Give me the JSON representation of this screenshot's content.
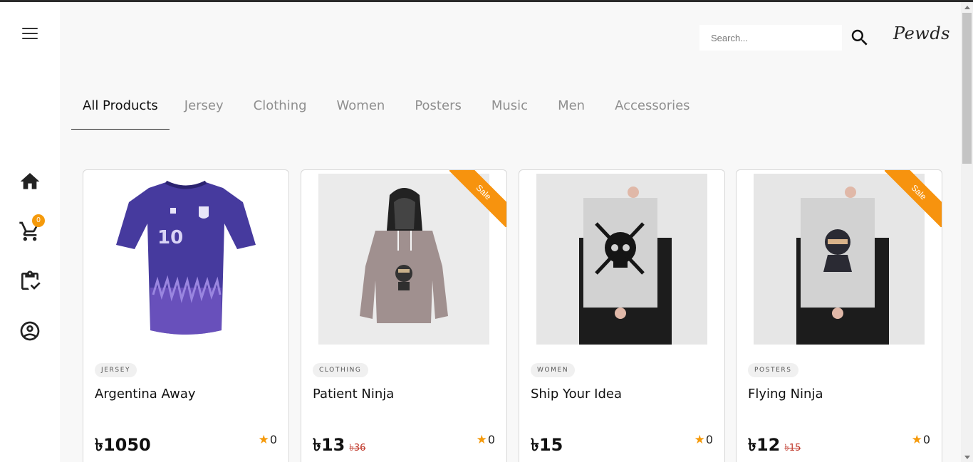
{
  "header": {
    "search_placeholder": "Search...",
    "logo": "Pewds"
  },
  "sidebar": {
    "cart_count": "0"
  },
  "tabs": [
    {
      "label": "All Products",
      "active": true
    },
    {
      "label": "Jersey"
    },
    {
      "label": "Clothing"
    },
    {
      "label": "Women"
    },
    {
      "label": "Posters"
    },
    {
      "label": "Music"
    },
    {
      "label": "Men"
    },
    {
      "label": "Accessories"
    }
  ],
  "products": [
    {
      "category": "JERSEY",
      "title": "Argentina Away",
      "price": "৳1050",
      "old_price": "",
      "rating_count": "0",
      "sale": false
    },
    {
      "category": "CLOTHING",
      "title": "Patient Ninja",
      "price": "৳13",
      "old_price": "৳36",
      "rating_count": "0",
      "sale": true,
      "sale_label": "Sale"
    },
    {
      "category": "WOMEN",
      "title": "Ship Your Idea",
      "price": "৳15",
      "old_price": "",
      "rating_count": "0",
      "sale": false
    },
    {
      "category": "POSTERS",
      "title": "Flying Ninja",
      "price": "৳12",
      "old_price": "৳15",
      "rating_count": "0",
      "sale": true,
      "sale_label": "Sale"
    }
  ],
  "colors": {
    "accent": "#f7930e",
    "jersey": "#4b3aa8",
    "old_price": "#c0392b"
  }
}
